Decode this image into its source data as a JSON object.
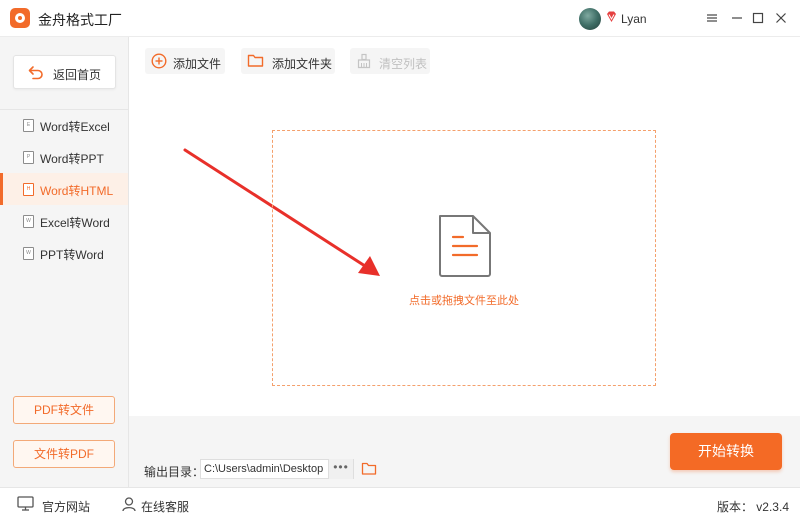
{
  "app": {
    "title": "金舟格式工厂",
    "user": "Lyan",
    "logo_icon": "app-logo-icon",
    "accent_color": "#f26b2a"
  },
  "window_controls": [
    {
      "name": "menu",
      "icon": "menu-icon"
    },
    {
      "name": "minimize",
      "icon": "minimize-icon"
    },
    {
      "name": "maximize",
      "icon": "maximize-icon"
    },
    {
      "name": "close",
      "icon": "close-icon"
    }
  ],
  "sidebar": {
    "back_label": "返回首页",
    "items": [
      {
        "label": "Word转Excel",
        "icon_letter": "E",
        "active": false
      },
      {
        "label": "Word转PPT",
        "icon_letter": "P",
        "active": false
      },
      {
        "label": "Word转HTML",
        "icon_letter": "H",
        "active": true
      },
      {
        "label": "Excel转Word",
        "icon_letter": "W",
        "active": false
      },
      {
        "label": "PPT转Word",
        "icon_letter": "W",
        "active": false
      }
    ],
    "bottom_buttons": [
      "PDF转文件",
      "文件转PDF"
    ]
  },
  "toolbar": {
    "add_file": "添加文件",
    "add_folder": "添加文件夹",
    "clear_list": "清空列表"
  },
  "dropzone": {
    "text": "点击或拖拽文件至此处",
    "icon": "document-icon"
  },
  "output": {
    "label": "输出目录：",
    "path": "C:\\Users\\admin\\Desktop",
    "more": "•••"
  },
  "start_button": "开始转换",
  "status": {
    "official_site": "官方网站",
    "support": "在线客服",
    "version": "版本： v2.3.4"
  }
}
